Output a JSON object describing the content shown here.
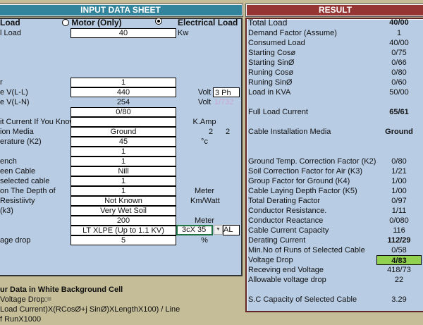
{
  "input_header": "INPUT DATA SHEET",
  "result_header": "RESULT",
  "load_type": {
    "label": "Load",
    "options": [
      {
        "label": "Motor (Only)",
        "selected": false
      },
      {
        "label": "Electrical Load",
        "selected": true
      }
    ]
  },
  "inputs": [
    {
      "label": "l Load",
      "value": "40",
      "unit": "Kw",
      "boxed": true
    },
    {
      "label": "r",
      "value": "1",
      "boxed": true
    },
    {
      "label": "e  V(L-L)",
      "value": "440",
      "unit": "Volt",
      "extra": "3 Ph",
      "boxed": true
    },
    {
      "label": "e  V(L-N)",
      "value": "254",
      "unit": "Volt",
      "extra": "1/732",
      "boxed": false
    },
    {
      "label": "",
      "value": "0/80",
      "boxed": true
    },
    {
      "label": "it Current If You Know",
      "value": "",
      "unit": "K.Amp",
      "boxed": true
    },
    {
      "label": "ion Media",
      "value": "Ground",
      "unit": "2",
      "extra": "2",
      "boxed": true
    },
    {
      "label": "erature (K2)",
      "value": "45",
      "unit": "°c",
      "boxed": true
    },
    {
      "label": "",
      "value": "1",
      "boxed": true
    },
    {
      "label": "ench",
      "value": "1",
      "boxed": true
    },
    {
      "label": "een Cable",
      "value": "Nill",
      "boxed": true
    },
    {
      "label": "selected cable",
      "value": "1",
      "boxed": true
    },
    {
      "label": "on The Depth of",
      "value": "1",
      "unit": "Meter",
      "boxed": true
    },
    {
      "label": "Resistiivty",
      "value": "Not Known",
      "unit": "Km/Watt",
      "boxed": true
    },
    {
      "label": "(k3)",
      "value": "Very Wet Soil",
      "boxed": true
    },
    {
      "label": "",
      "value": "200",
      "unit": "Meter",
      "boxed": true
    },
    {
      "label": "",
      "value": "LT XLPE (Up to 1.1 KV)",
      "boxed": true
    },
    {
      "label": "age drop",
      "value": "5",
      "unit": "%",
      "boxed": true
    }
  ],
  "cable_size": {
    "value": "3cX 35",
    "material": "AL"
  },
  "notes": [
    "ur Data in White Background Cell",
    " Voltage Drop:=",
    "Load Current)X(RCosØ+j SinØ)XLengthX100) / Line",
    "f RunX1000"
  ],
  "results": [
    {
      "label": "Total Load",
      "value": "40/00",
      "bold": true
    },
    {
      "label": "Demand Factor (Assume)",
      "value": "1"
    },
    {
      "label": "Consumed Load",
      "value": "40/00"
    },
    {
      "label": "Starting Cosø",
      "value": "0/75"
    },
    {
      "label": "Starting SinØ",
      "value": "0/66"
    },
    {
      "label": "Runing Cosø",
      "value": "0/80"
    },
    {
      "label": "Runing SinØ",
      "value": "0/60"
    },
    {
      "label": "Load in  KVA",
      "value": "50/00"
    },
    {
      "label": "Full Load Current",
      "value": "65/61",
      "bold": true
    },
    {
      "label": "Cable Installation Media",
      "value": "Ground",
      "bold": true
    },
    {
      "label": "Ground Temp. Correction Factor (K2)",
      "value": "0/80"
    },
    {
      "label": "Soil Correction Factor for Air (K3)",
      "value": "1/21"
    },
    {
      "label": "Group Factor for Ground (K4)",
      "value": "1/00"
    },
    {
      "label": "Cable Laying Depth Factor (K5)",
      "value": "1/00"
    },
    {
      "label": "Total Derating Factor",
      "value": "0/97"
    },
    {
      "label": "Conductor Resistance.",
      "value": "1/11"
    },
    {
      "label": "Conductor Reactance",
      "value": "0/080"
    },
    {
      "label": "Cable Current Capacity",
      "value": "116"
    },
    {
      "label": "Derating  Current",
      "value": "112/29",
      "bold": true
    },
    {
      "label": "Min.No of Runs of Selected Cable",
      "value": "0/58"
    },
    {
      "label": "Voltage Drop",
      "value": "4/83",
      "bold": true,
      "highlight": "#92d050"
    },
    {
      "label": "Receving end Voltage",
      "value": "418/73"
    },
    {
      "label": "Allowable voltage drop",
      "value": "22"
    },
    {
      "label": "S.C Capacity of Selected Cable",
      "value": "3.29"
    }
  ]
}
